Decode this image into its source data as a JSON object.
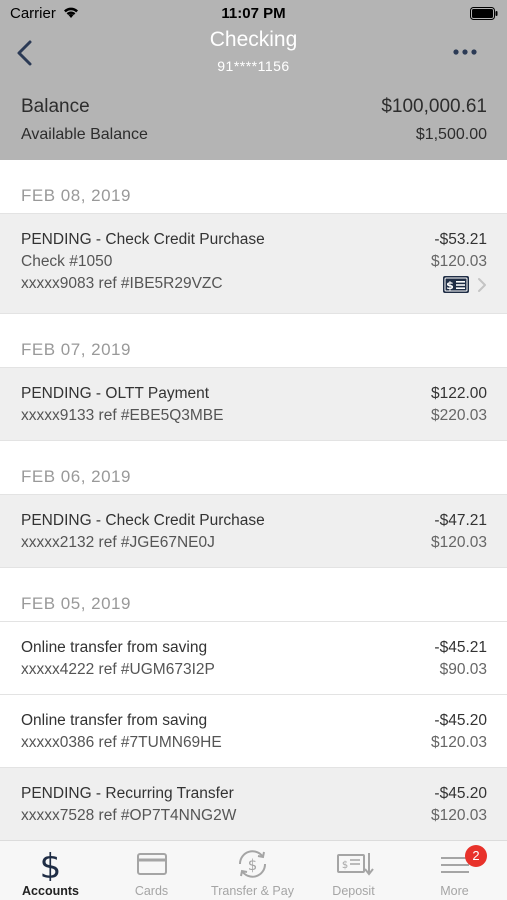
{
  "status_bar": {
    "carrier": "Carrier",
    "time": "11:07 PM"
  },
  "nav": {
    "title": "Checking",
    "account_number": "91****1156"
  },
  "summary": {
    "balance_label": "Balance",
    "balance_value": "$100,000.61",
    "available_label": "Available Balance",
    "available_value": "$1,500.00"
  },
  "groups": [
    {
      "date": "FEB 08, 2019",
      "transactions": [
        {
          "title": "PENDING - Check Credit Purchase",
          "detail": "Check #1050",
          "ref": "xxxxx9083 ref #IBE5R29VZC",
          "amount": "-$53.21",
          "running_balance": "$120.03",
          "pending": true,
          "has_check": true
        }
      ]
    },
    {
      "date": "FEB 07, 2019",
      "transactions": [
        {
          "title": "PENDING - OLTT Payment",
          "ref": "xxxxx9133 ref #EBE5Q3MBE",
          "amount": "$122.00",
          "running_balance": "$220.03",
          "pending": true
        }
      ]
    },
    {
      "date": "FEB 06, 2019",
      "transactions": [
        {
          "title": "PENDING - Check Credit Purchase",
          "ref": "xxxxx2132 ref #JGE67NE0J",
          "amount": "-$47.21",
          "running_balance": "$120.03",
          "pending": true
        }
      ]
    },
    {
      "date": "FEB 05, 2019",
      "transactions": [
        {
          "title": "Online transfer from saving",
          "ref": "xxxxx4222 ref #UGM673I2P",
          "amount": "-$45.21",
          "running_balance": "$90.03",
          "pending": false
        },
        {
          "title": "Online transfer from saving",
          "ref": "xxxxx0386 ref #7TUMN69HE",
          "amount": "-$45.20",
          "running_balance": "$120.03",
          "pending": false
        },
        {
          "title": "PENDING - Recurring Transfer",
          "ref": "xxxxx7528 ref #OP7T4NNG2W",
          "amount": "-$45.20",
          "running_balance": "$120.03",
          "pending": true
        }
      ]
    }
  ],
  "tabs": [
    {
      "label": "Accounts",
      "icon": "dollar-icon",
      "active": true
    },
    {
      "label": "Cards",
      "icon": "card-icon",
      "active": false
    },
    {
      "label": "Transfer & Pay",
      "icon": "transfer-icon",
      "active": false
    },
    {
      "label": "Deposit",
      "icon": "deposit-icon",
      "active": false
    },
    {
      "label": "More",
      "icon": "menu-icon",
      "active": false,
      "badge": "2"
    }
  ],
  "colors": {
    "header_bg": "#b4b4b4",
    "pending_bg": "#efefef",
    "badge": "#e8322b",
    "active_tab": "#222222",
    "inactive_tab": "#a5a5a5"
  }
}
